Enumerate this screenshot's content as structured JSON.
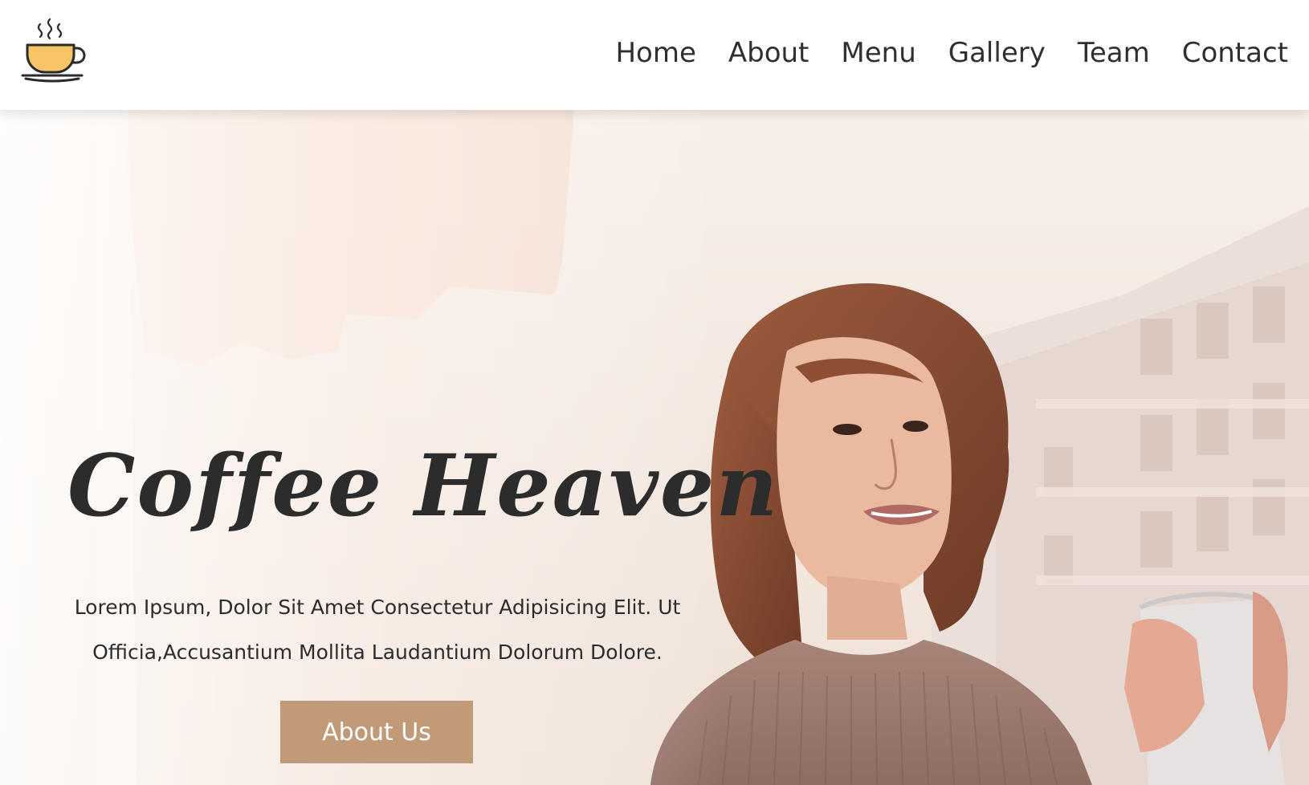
{
  "nav": {
    "logo_icon": "coffee-cup-icon",
    "items": [
      {
        "label": "Home"
      },
      {
        "label": "About"
      },
      {
        "label": "Menu"
      },
      {
        "label": "Gallery"
      },
      {
        "label": "Team"
      },
      {
        "label": "Contact"
      }
    ]
  },
  "hero": {
    "title": "Coffee Heaven",
    "text": "Lorem Ipsum, Dolor Sit Amet Consectetur Adipisicing Elit. Ut Officia,Accusantium Mollita Laudantium Dolorum Dolore.",
    "button_label": "About Us",
    "background_image": "woman-holding-coffee-cup-photo"
  },
  "colors": {
    "accent": "#c19a77",
    "text": "#2c2c2c",
    "logo_cup": "#f7c468"
  }
}
